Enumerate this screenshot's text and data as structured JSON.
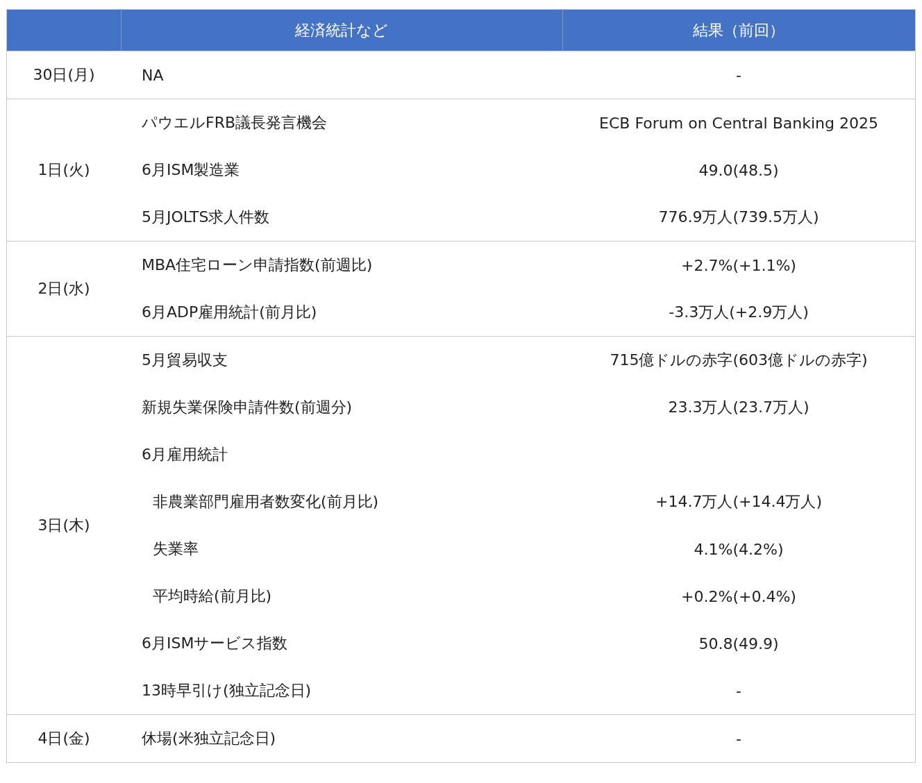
{
  "table": {
    "columns": [
      {
        "label": "経済統計など"
      },
      {
        "label": "結果（前回）"
      }
    ],
    "days": [
      {
        "date": "30日(月)",
        "events": [
          {
            "name": "NA",
            "result": "-"
          }
        ]
      },
      {
        "date": "1日(火)",
        "events": [
          {
            "name": "パウエルFRB議長発言機会",
            "result": "ECB Forum on Central Banking 2025"
          },
          {
            "name": "6月ISM製造業",
            "result": "49.0(48.5)"
          },
          {
            "name": "5月JOLTS求人件数",
            "result": "776.9万人(739.5万人)"
          }
        ]
      },
      {
        "date": "2日(水)",
        "events": [
          {
            "name": "MBA住宅ローン申請指数(前週比)",
            "result": "+2.7%(+1.1%)"
          },
          {
            "name": "6月ADP雇用統計(前月比)",
            "result": "-3.3万人(+2.9万人)"
          }
        ]
      },
      {
        "date": "3日(木)",
        "events": [
          {
            "name": "5月貿易収支",
            "result": "715億ドルの赤字(603億ドルの赤字)"
          },
          {
            "name": "新規失業保険申請件数(前週分)",
            "result": "23.3万人(23.7万人)"
          },
          {
            "name": "6月雇用統計",
            "children": [
              {
                "name": "非農業部門雇用者数変化(前月比)",
                "result": "+14.7万人(+14.4万人)"
              },
              {
                "name": "失業率",
                "result": "4.1%(4.2%)"
              },
              {
                "name": "平均時給(前月比)",
                "result": "+0.2%(+0.4%)"
              }
            ]
          },
          {
            "name": "6月ISMサービス指数",
            "result": "50.8(49.9)"
          },
          {
            "name": "13時早引け(独立記念日)",
            "result": "-"
          }
        ]
      },
      {
        "date": "4日(金)",
        "events": [
          {
            "name": "休場(米独立記念日)",
            "result": "-"
          }
        ]
      }
    ]
  }
}
